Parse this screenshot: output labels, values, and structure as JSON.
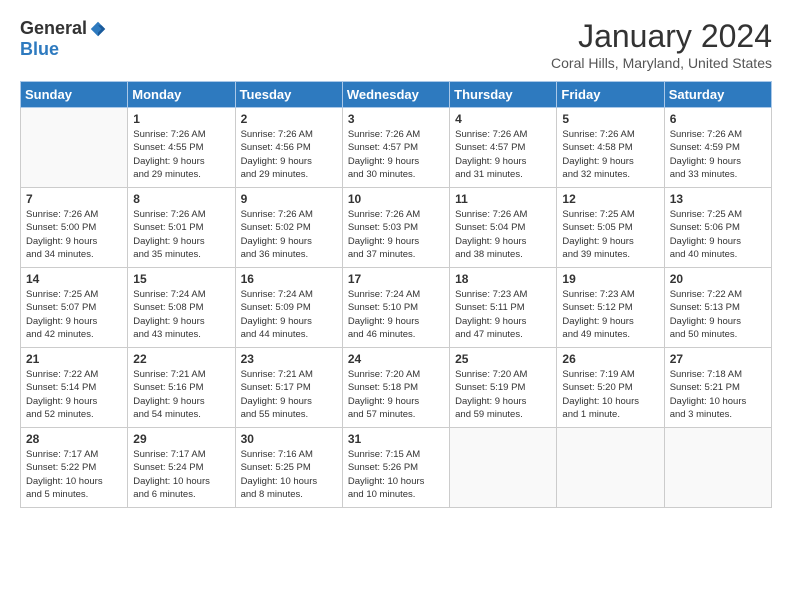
{
  "header": {
    "logo_general": "General",
    "logo_blue": "Blue",
    "month_title": "January 2024",
    "location": "Coral Hills, Maryland, United States"
  },
  "days_of_week": [
    "Sunday",
    "Monday",
    "Tuesday",
    "Wednesday",
    "Thursday",
    "Friday",
    "Saturday"
  ],
  "weeks": [
    [
      {
        "day": "",
        "info": ""
      },
      {
        "day": "1",
        "info": "Sunrise: 7:26 AM\nSunset: 4:55 PM\nDaylight: 9 hours\nand 29 minutes."
      },
      {
        "day": "2",
        "info": "Sunrise: 7:26 AM\nSunset: 4:56 PM\nDaylight: 9 hours\nand 29 minutes."
      },
      {
        "day": "3",
        "info": "Sunrise: 7:26 AM\nSunset: 4:57 PM\nDaylight: 9 hours\nand 30 minutes."
      },
      {
        "day": "4",
        "info": "Sunrise: 7:26 AM\nSunset: 4:57 PM\nDaylight: 9 hours\nand 31 minutes."
      },
      {
        "day": "5",
        "info": "Sunrise: 7:26 AM\nSunset: 4:58 PM\nDaylight: 9 hours\nand 32 minutes."
      },
      {
        "day": "6",
        "info": "Sunrise: 7:26 AM\nSunset: 4:59 PM\nDaylight: 9 hours\nand 33 minutes."
      }
    ],
    [
      {
        "day": "7",
        "info": "Sunrise: 7:26 AM\nSunset: 5:00 PM\nDaylight: 9 hours\nand 34 minutes."
      },
      {
        "day": "8",
        "info": "Sunrise: 7:26 AM\nSunset: 5:01 PM\nDaylight: 9 hours\nand 35 minutes."
      },
      {
        "day": "9",
        "info": "Sunrise: 7:26 AM\nSunset: 5:02 PM\nDaylight: 9 hours\nand 36 minutes."
      },
      {
        "day": "10",
        "info": "Sunrise: 7:26 AM\nSunset: 5:03 PM\nDaylight: 9 hours\nand 37 minutes."
      },
      {
        "day": "11",
        "info": "Sunrise: 7:26 AM\nSunset: 5:04 PM\nDaylight: 9 hours\nand 38 minutes."
      },
      {
        "day": "12",
        "info": "Sunrise: 7:25 AM\nSunset: 5:05 PM\nDaylight: 9 hours\nand 39 minutes."
      },
      {
        "day": "13",
        "info": "Sunrise: 7:25 AM\nSunset: 5:06 PM\nDaylight: 9 hours\nand 40 minutes."
      }
    ],
    [
      {
        "day": "14",
        "info": "Sunrise: 7:25 AM\nSunset: 5:07 PM\nDaylight: 9 hours\nand 42 minutes."
      },
      {
        "day": "15",
        "info": "Sunrise: 7:24 AM\nSunset: 5:08 PM\nDaylight: 9 hours\nand 43 minutes."
      },
      {
        "day": "16",
        "info": "Sunrise: 7:24 AM\nSunset: 5:09 PM\nDaylight: 9 hours\nand 44 minutes."
      },
      {
        "day": "17",
        "info": "Sunrise: 7:24 AM\nSunset: 5:10 PM\nDaylight: 9 hours\nand 46 minutes."
      },
      {
        "day": "18",
        "info": "Sunrise: 7:23 AM\nSunset: 5:11 PM\nDaylight: 9 hours\nand 47 minutes."
      },
      {
        "day": "19",
        "info": "Sunrise: 7:23 AM\nSunset: 5:12 PM\nDaylight: 9 hours\nand 49 minutes."
      },
      {
        "day": "20",
        "info": "Sunrise: 7:22 AM\nSunset: 5:13 PM\nDaylight: 9 hours\nand 50 minutes."
      }
    ],
    [
      {
        "day": "21",
        "info": "Sunrise: 7:22 AM\nSunset: 5:14 PM\nDaylight: 9 hours\nand 52 minutes."
      },
      {
        "day": "22",
        "info": "Sunrise: 7:21 AM\nSunset: 5:16 PM\nDaylight: 9 hours\nand 54 minutes."
      },
      {
        "day": "23",
        "info": "Sunrise: 7:21 AM\nSunset: 5:17 PM\nDaylight: 9 hours\nand 55 minutes."
      },
      {
        "day": "24",
        "info": "Sunrise: 7:20 AM\nSunset: 5:18 PM\nDaylight: 9 hours\nand 57 minutes."
      },
      {
        "day": "25",
        "info": "Sunrise: 7:20 AM\nSunset: 5:19 PM\nDaylight: 9 hours\nand 59 minutes."
      },
      {
        "day": "26",
        "info": "Sunrise: 7:19 AM\nSunset: 5:20 PM\nDaylight: 10 hours\nand 1 minute."
      },
      {
        "day": "27",
        "info": "Sunrise: 7:18 AM\nSunset: 5:21 PM\nDaylight: 10 hours\nand 3 minutes."
      }
    ],
    [
      {
        "day": "28",
        "info": "Sunrise: 7:17 AM\nSunset: 5:22 PM\nDaylight: 10 hours\nand 5 minutes."
      },
      {
        "day": "29",
        "info": "Sunrise: 7:17 AM\nSunset: 5:24 PM\nDaylight: 10 hours\nand 6 minutes."
      },
      {
        "day": "30",
        "info": "Sunrise: 7:16 AM\nSunset: 5:25 PM\nDaylight: 10 hours\nand 8 minutes."
      },
      {
        "day": "31",
        "info": "Sunrise: 7:15 AM\nSunset: 5:26 PM\nDaylight: 10 hours\nand 10 minutes."
      },
      {
        "day": "",
        "info": ""
      },
      {
        "day": "",
        "info": ""
      },
      {
        "day": "",
        "info": ""
      }
    ]
  ]
}
